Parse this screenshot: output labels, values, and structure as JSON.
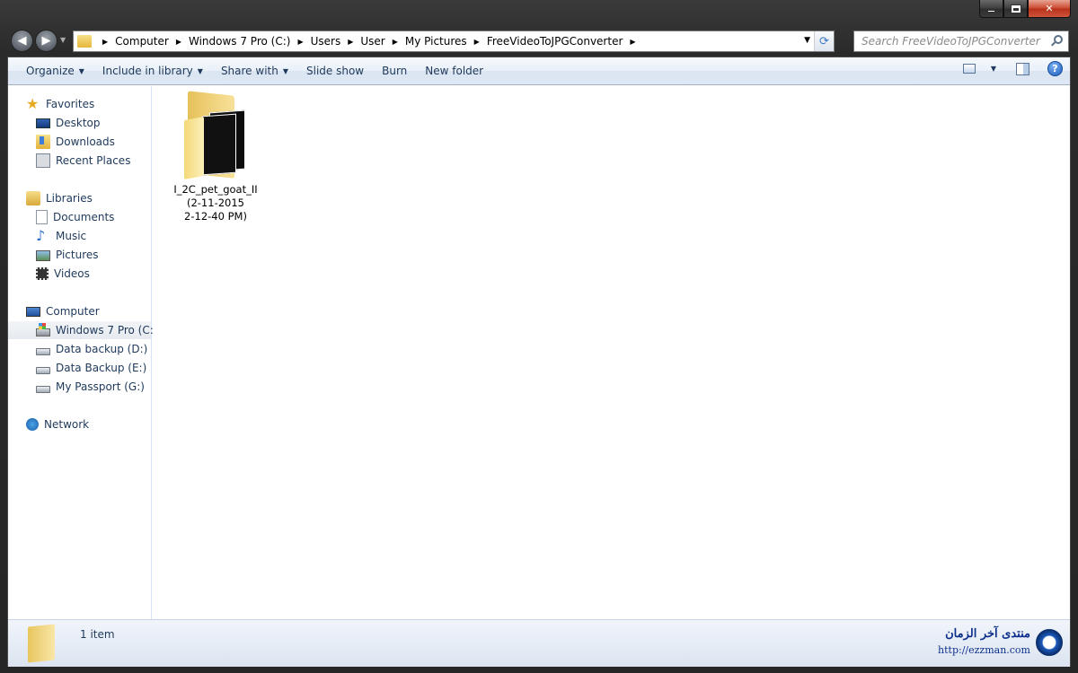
{
  "window": {
    "caption_buttons": [
      "minimize",
      "maximize",
      "close"
    ]
  },
  "address": {
    "breadcrumbs": [
      "Computer",
      "Windows 7 Pro  (C:)",
      "Users",
      "User",
      "My Pictures",
      "FreeVideoToJPGConverter"
    ],
    "search_placeholder": "Search FreeVideoToJPGConverter"
  },
  "toolbar": {
    "organize": "Organize",
    "include_in_library": "Include in library",
    "share_with": "Share with",
    "slide_show": "Slide show",
    "burn": "Burn",
    "new_folder": "New folder",
    "help": "?"
  },
  "nav": {
    "favorites": "Favorites",
    "desktop": "Desktop",
    "downloads": "Downloads",
    "recent_places": "Recent Places",
    "libraries": "Libraries",
    "documents": "Documents",
    "music": "Music",
    "pictures": "Pictures",
    "videos": "Videos",
    "computer": "Computer",
    "drive_c": "Windows 7 Pro  (C:)",
    "drive_d": "Data backup  (D:)",
    "drive_e": "Data Backup  (E:)",
    "drive_g": "My Passport (G:)",
    "network": "Network",
    "selected": "Windows 7 Pro  (C:)"
  },
  "content": {
    "items": [
      {
        "name_line1": "I_2C_pet_goat_II",
        "name_line2": "(2-11-2015",
        "name_line3": "2-12-40 PM)",
        "icon": "folder-icon"
      }
    ]
  },
  "details": {
    "item_count": "1 item"
  },
  "watermark": {
    "arabic": "منتدى آخر الزمان",
    "url": "http://ezzman.com"
  }
}
